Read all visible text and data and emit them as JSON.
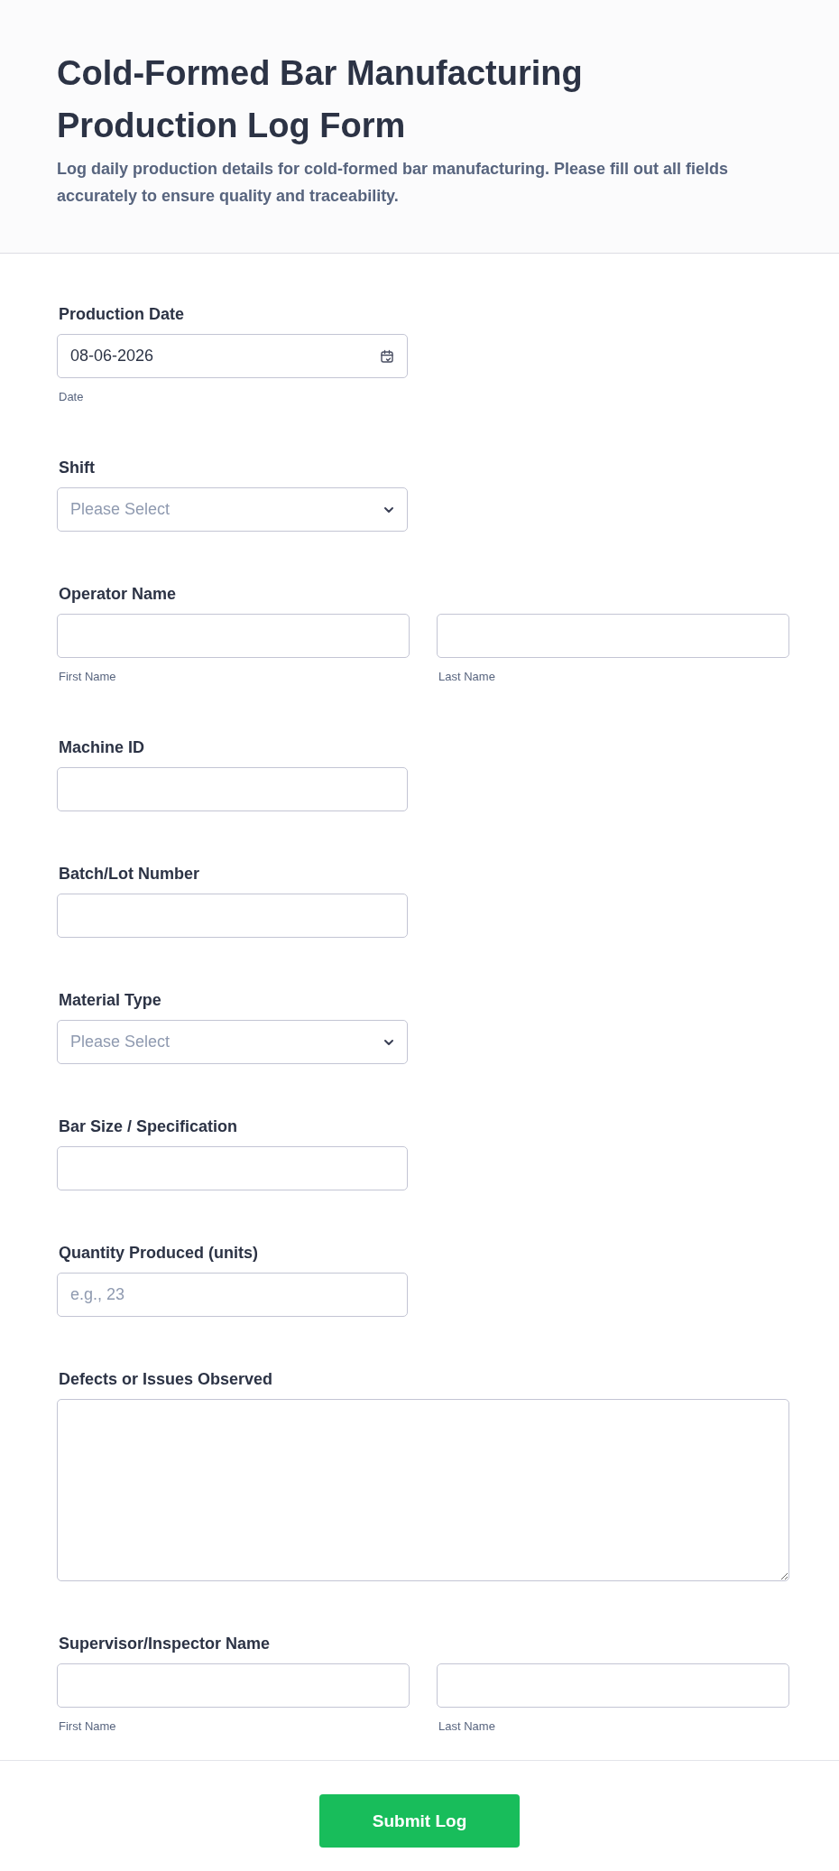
{
  "header": {
    "title": "Cold-Formed Bar Manufacturing Production Log Form",
    "description": "Log daily production details for cold-formed bar manufacturing. Please fill out all fields accurately to ensure quality and traceability."
  },
  "fields": [
    {
      "kind": "date",
      "label": "Production Date",
      "value": "08-06-2026",
      "sublabel": "Date"
    },
    {
      "kind": "select",
      "label": "Shift",
      "placeholder": "Please Select"
    },
    {
      "kind": "name",
      "label": "Operator Name",
      "sublabels": [
        "First Name",
        "Last Name"
      ]
    },
    {
      "kind": "text",
      "label": "Machine ID"
    },
    {
      "kind": "text",
      "label": "Batch/Lot Number"
    },
    {
      "kind": "select",
      "label": "Material Type",
      "placeholder": "Please Select"
    },
    {
      "kind": "text",
      "label": "Bar Size / Specification"
    },
    {
      "kind": "text",
      "label": "Quantity Produced (units)",
      "placeholder": "e.g., 23"
    },
    {
      "kind": "textarea",
      "label": "Defects or Issues Observed"
    },
    {
      "kind": "name",
      "label": "Supervisor/Inspector Name",
      "sublabels": [
        "First Name",
        "Last Name"
      ]
    }
  ],
  "submit": {
    "label": "Submit Log"
  }
}
